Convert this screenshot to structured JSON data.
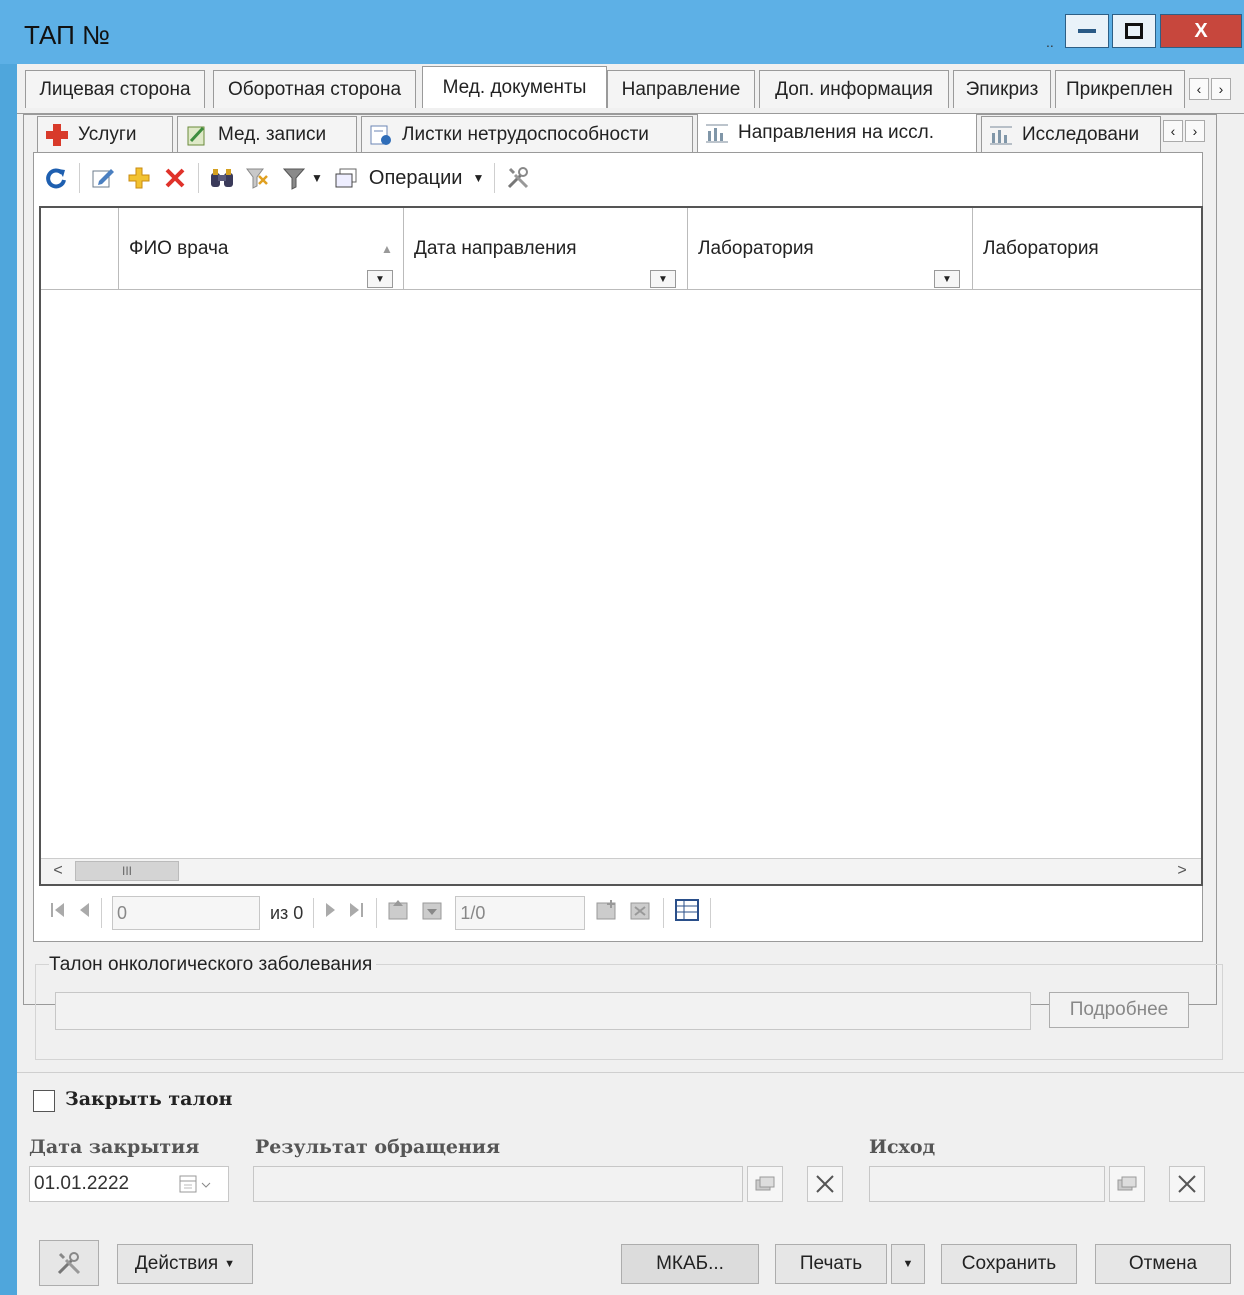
{
  "window": {
    "title": "ТАП №",
    "close_label": "X"
  },
  "outer_tabs": [
    {
      "label": "Лицевая сторона"
    },
    {
      "label": "Оборотная сторона"
    },
    {
      "label": "Мед. документы"
    },
    {
      "label": "Направление"
    },
    {
      "label": "Доп. информация"
    },
    {
      "label": "Эпикриз"
    },
    {
      "label": "Прикреплен"
    }
  ],
  "inner_tabs": [
    {
      "label": "Услуги",
      "icon": "services-cross-icon"
    },
    {
      "label": "Мед. записи",
      "icon": "med-notes-icon"
    },
    {
      "label": "Листки нетрудоспособности",
      "icon": "sick-leave-icon"
    },
    {
      "label": "Направления на иссл.",
      "icon": "research-chart-icon"
    },
    {
      "label": "Исследовани",
      "icon": "research-chart-icon"
    }
  ],
  "toolbar": {
    "operations_label": "Операции"
  },
  "grid": {
    "columns": [
      {
        "label": "ФИО врача"
      },
      {
        "label": "Дата направления"
      },
      {
        "label": "Лаборатория"
      },
      {
        "label": "Лаборатория"
      }
    ]
  },
  "pager": {
    "page_value": "0",
    "of_total": "из 0",
    "position": "1/0"
  },
  "onco": {
    "group_label": "Талон онкологического заболевания",
    "details_label": "Подробнее"
  },
  "closing": {
    "close_ticket_label": "Закрыть талон",
    "close_date_label": "Дата закрытия",
    "close_date_value": "01.01.2222",
    "result_label": "Результат обращения",
    "outcome_label": "Исход"
  },
  "footer": {
    "actions_label": "Действия",
    "mkab_label": "МКАБ...",
    "print_label": "Печать",
    "save_label": "Сохранить",
    "cancel_label": "Отмена"
  },
  "colors": {
    "titlebar": "#5db0e6",
    "close_button": "#c7473d"
  }
}
